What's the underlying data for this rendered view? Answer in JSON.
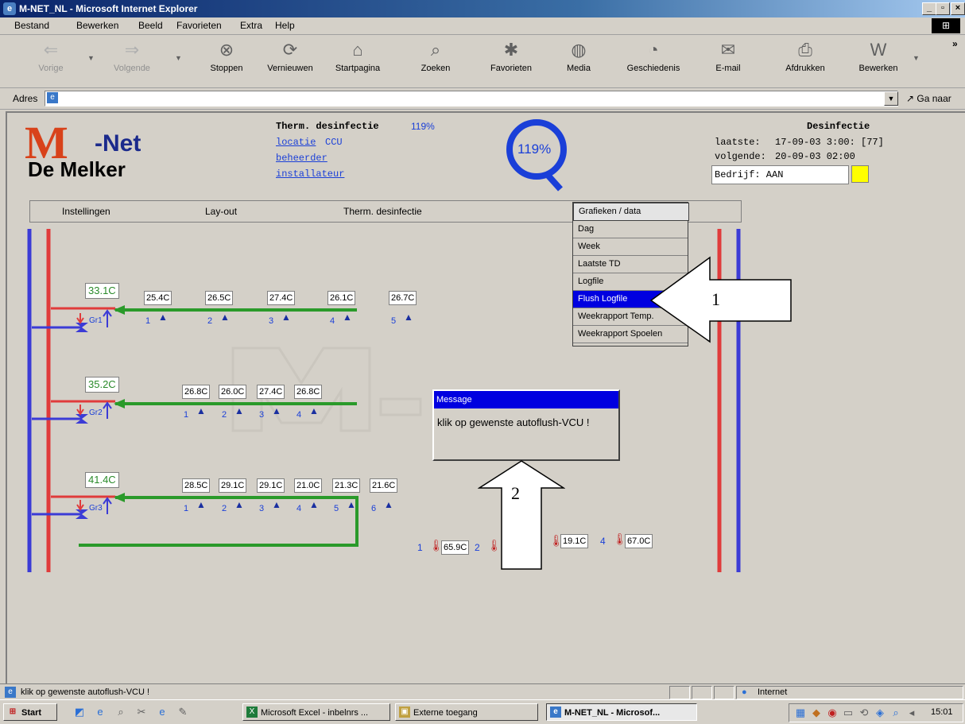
{
  "window": {
    "title": "M-NET_NL - Microsoft Internet Explorer",
    "min": "_",
    "max": "▫",
    "close": "×"
  },
  "menu": [
    "Bestand",
    "Bewerken",
    "Beeld",
    "Favorieten",
    "Extra",
    "Help"
  ],
  "toolbar": {
    "back": "Vorige",
    "forward": "Volgende",
    "stop": "Stoppen",
    "refresh": "Vernieuwen",
    "home": "Startpagina",
    "search": "Zoeken",
    "favorites": "Favorieten",
    "media": "Media",
    "history": "Geschiedenis",
    "mail": "E-mail",
    "print": "Afdrukken",
    "edit": "Bewerken",
    "more": "»"
  },
  "address": {
    "label": "Adres",
    "value": "",
    "go": "Ga naar"
  },
  "app": {
    "logo_sub": "De Melker",
    "logo_net": "-Net",
    "header_title": "Therm. desinfectie",
    "header_pct": "119%",
    "link_locatie": "locatie",
    "locatie_value": "CCU",
    "link_beheerder": "beheerder",
    "link_installateur": "installateur",
    "gauge_value": "119%",
    "desinfectie": {
      "title": "Desinfectie",
      "last_label": "laatste:",
      "last_value": "17-09-03 3:00: [77]",
      "next_label": "volgende:",
      "next_value": "20-09-03 02:00",
      "bedrijf": "Bedrijf: AAN",
      "indicator_color": "#ffff00"
    },
    "nav": {
      "instellingen": "Instellingen",
      "layout": "Lay-out",
      "therm": "Therm. desinfectie",
      "grafieken": "Grafieken / data"
    },
    "dropdown": [
      "Dag",
      "Week",
      "Laatste TD",
      "Logfile",
      "Flush Logfile",
      "Weekrapport Temp.",
      "Weekrapport Spoelen"
    ],
    "groups": [
      {
        "label": "Gr1",
        "temp": "33.1C",
        "taps": [
          "25.4C",
          "26.5C",
          "27.4C",
          "26.1C",
          "26.7C"
        ],
        "nums": [
          "1",
          "2",
          "3",
          "4",
          "5"
        ]
      },
      {
        "label": "Gr2",
        "temp": "35.2C",
        "taps": [
          "26.8C",
          "26.0C",
          "27.4C",
          "26.8C"
        ],
        "nums": [
          "1",
          "2",
          "3",
          "4"
        ]
      },
      {
        "label": "Gr3",
        "temp": "41.4C",
        "taps": [
          "28.5C",
          "29.1C",
          "29.1C",
          "21.0C",
          "21.3C",
          "21.6C"
        ],
        "nums": [
          "1",
          "2",
          "3",
          "4",
          "5",
          "6"
        ]
      }
    ],
    "boilers": {
      "n1": "1",
      "t1": "65.9C",
      "n2": "2",
      "t3": "19.1C",
      "n4": "4",
      "t4": "67.0C"
    },
    "message": {
      "title": "Message",
      "text": "klik op gewenste autoflush-VCU !"
    },
    "arrow1": "1",
    "arrow2": "2"
  },
  "status": {
    "text": "klik op gewenste autoflush-VCU !",
    "zone": "Internet"
  },
  "taskbar": {
    "start": "Start",
    "tasks": [
      "Microsoft Excel - inbelnrs ...",
      "Externe toegang",
      "M-NET_NL - Microsof..."
    ],
    "clock": "15:01"
  }
}
